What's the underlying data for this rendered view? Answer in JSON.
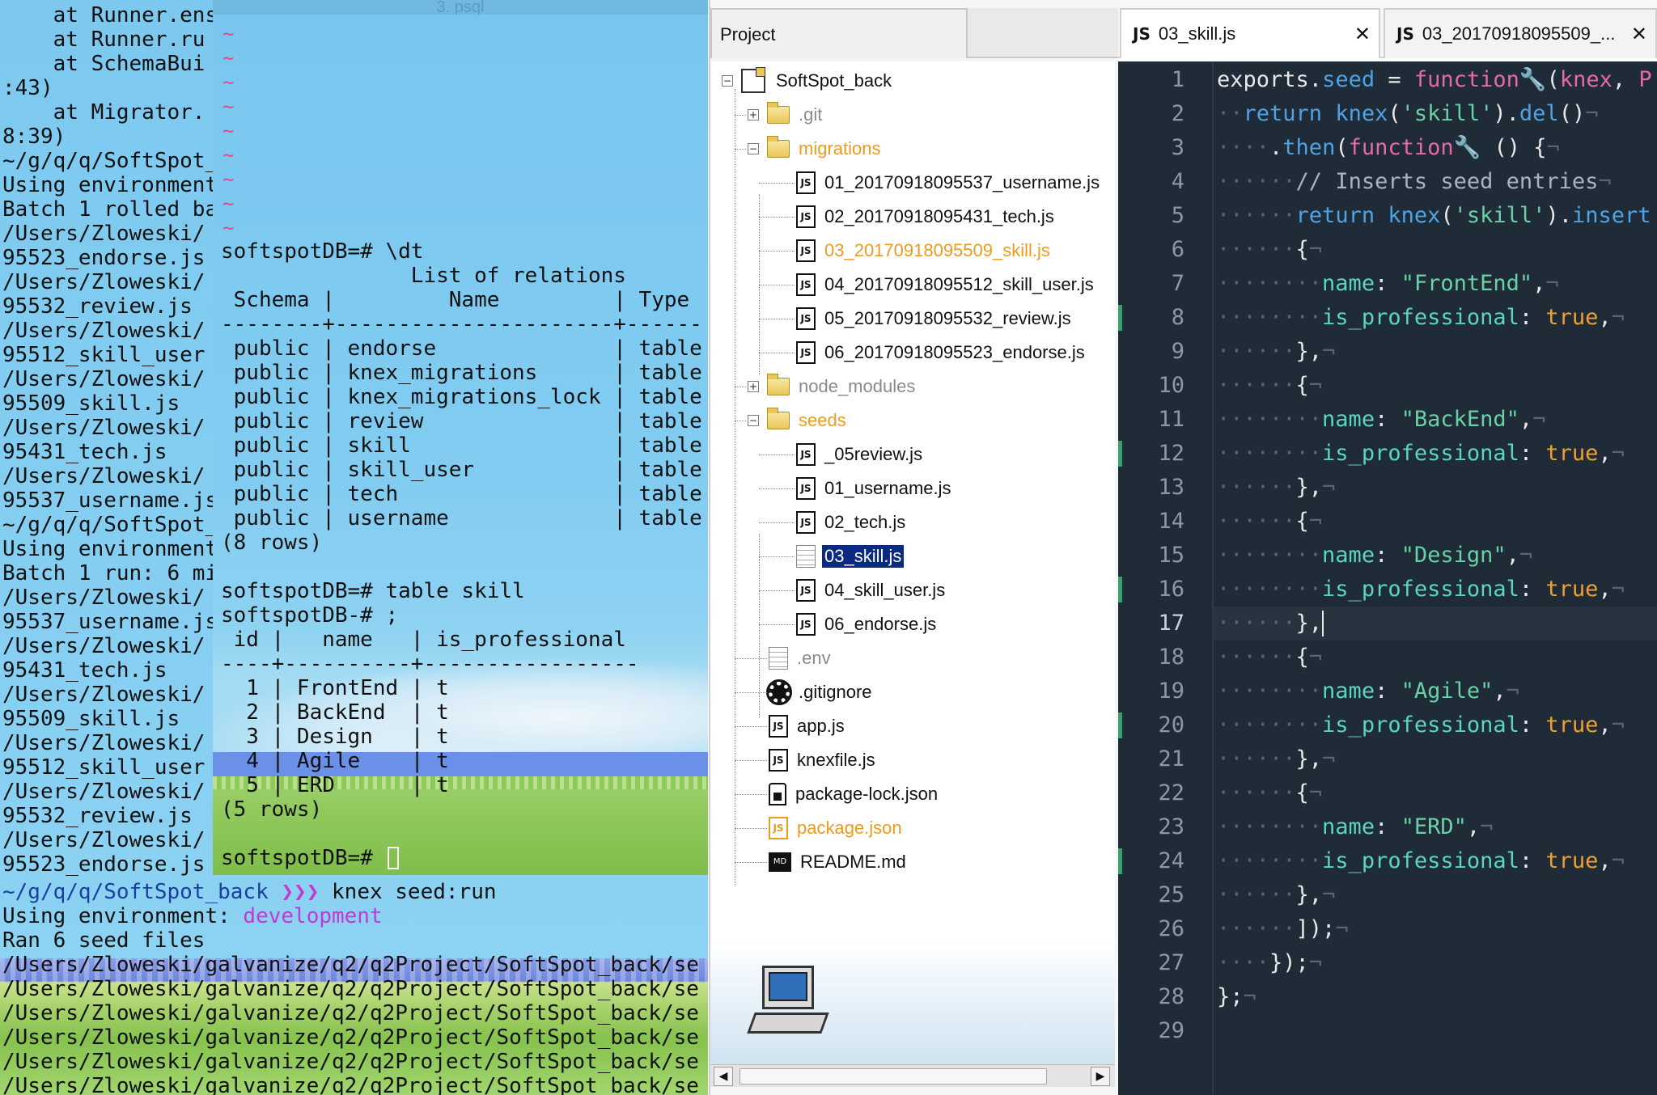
{
  "back_terminal": {
    "lines": [
      {
        "text": "    at Runner.ens",
        "cls": "c-dk"
      },
      {
        "text": "    at Runner.ru",
        "cls": "c-dk"
      },
      {
        "text": "    at SchemaBui",
        "cls": "c-dk"
      },
      {
        "text": ":43)",
        "cls": "c-dk"
      },
      {
        "text": "    at Migrator.",
        "cls": "c-dk"
      },
      {
        "text": "8:39)",
        "cls": "c-dk"
      },
      {
        "text": "~/g/q/q/SoftSpot_",
        "cls": "c-blue"
      },
      {
        "text": "Using environment",
        "cls": "c-dk"
      },
      {
        "text": "Batch 1 rolled ba",
        "cls": "c-green"
      },
      {
        "text": "/Users/Zloweski/",
        "cls": "c-teal"
      },
      {
        "text": "95523_endorse.js",
        "cls": "c-teal"
      },
      {
        "text": "/Users/Zloweski/",
        "cls": "c-teal"
      },
      {
        "text": "95532_review.js",
        "cls": "c-teal"
      },
      {
        "text": "/Users/Zloweski/",
        "cls": "c-teal"
      },
      {
        "text": "95512_skill_user",
        "cls": "c-teal"
      },
      {
        "text": "/Users/Zloweski/",
        "cls": "c-teal"
      },
      {
        "text": "95509_skill.js",
        "cls": "c-teal"
      },
      {
        "text": "/Users/Zloweski/",
        "cls": "c-teal"
      },
      {
        "text": "95431_tech.js",
        "cls": "c-teal"
      },
      {
        "text": "/Users/Zloweski/",
        "cls": "c-teal"
      },
      {
        "text": "95537_username.js",
        "cls": "c-teal"
      },
      {
        "text": "~/g/q/q/SoftSpot_",
        "cls": "c-blue"
      },
      {
        "text": "Using environment",
        "cls": "c-dk"
      },
      {
        "text": "Batch 1 run: 6 mi",
        "cls": "c-green"
      },
      {
        "text": "/Users/Zloweski/",
        "cls": "c-teal"
      },
      {
        "text": "95537_username.js",
        "cls": "c-teal"
      },
      {
        "text": "/Users/Zloweski/",
        "cls": "c-teal"
      },
      {
        "text": "95431_tech.js",
        "cls": "c-teal"
      },
      {
        "text": "/Users/Zloweski/",
        "cls": "c-teal"
      },
      {
        "text": "95509_skill.js",
        "cls": "c-teal"
      },
      {
        "text": "/Users/Zloweski/",
        "cls": "c-teal"
      },
      {
        "text": "95512_skill_user",
        "cls": "c-teal"
      },
      {
        "text": "/Users/Zloweski/",
        "cls": "c-teal"
      },
      {
        "text": "95532_review.js",
        "cls": "c-teal"
      },
      {
        "text": "/Users/Zloweski/",
        "cls": "c-teal"
      },
      {
        "text": "95523_endorse.js",
        "cls": "c-teal"
      }
    ],
    "prompt_path": "~/g/q/q/SoftSpot_back",
    "prompt_arrows": "❯❯❯",
    "command": "knex seed:run",
    "env_label": "Using environment:",
    "env_value": "development",
    "ran_message": "Ran 6 seed files",
    "seed_paths": [
      "/Users/Zloweski/galvanize/q2/q2Project/SoftSpot_back/se",
      "/Users/Zloweski/galvanize/q2/q2Project/SoftSpot_back/se",
      "/Users/Zloweski/galvanize/q2/q2Project/SoftSpot_back/se",
      "/Users/Zloweski/galvanize/q2/q2Project/SoftSpot_back/se",
      "/Users/Zloweski/galvanize/q2/q2Project/SoftSpot_back/se",
      "/Users/Zloweski/galvanize/q2/q2Project/SoftSpot_back/se"
    ]
  },
  "psql": {
    "title": "3. psql",
    "tildes": [
      "~",
      "~",
      "~",
      "~",
      "~",
      "~",
      "~",
      "~",
      "~"
    ],
    "lines": [
      "softspotDB=# \\dt",
      "               List of relations",
      " Schema |         Name         | Type",
      "--------+----------------------+------",
      " public | endorse              | table",
      " public | knex_migrations      | table",
      " public | knex_migrations_lock | table",
      " public | review               | table",
      " public | skill                | table",
      " public | skill_user           | table",
      " public | tech                 | table",
      " public | username             | table",
      "(8 rows)",
      "",
      "softspotDB=# table skill",
      "softspotDB-# ;",
      " id |   name   | is_professional",
      "----+----------+-----------------",
      "  1 | FrontEnd | t",
      "  2 | BackEnd  | t",
      "  3 | Design   | t",
      "  4 | Agile    | t",
      "  5 | ERD      | t",
      "(5 rows)",
      "",
      "softspotDB=# "
    ]
  },
  "project": {
    "title": "Project",
    "scroll_left": "◀",
    "scroll_right": "▶",
    "tree": [
      {
        "label": "SoftSpot_back",
        "icon": "project-icon",
        "depth": 0,
        "toggle": "−",
        "style": ""
      },
      {
        "label": ".git",
        "icon": "folder-icon",
        "depth": 1,
        "toggle": "+",
        "style": "dim"
      },
      {
        "label": "migrations",
        "icon": "folder-open-icon",
        "depth": 1,
        "toggle": "−",
        "style": "orange"
      },
      {
        "label": "01_20170918095537_username.js",
        "icon": "js-file-icon",
        "depth": 2,
        "toggle": "",
        "style": ""
      },
      {
        "label": "02_20170918095431_tech.js",
        "icon": "js-file-icon",
        "depth": 2,
        "toggle": "",
        "style": ""
      },
      {
        "label": "03_20170918095509_skill.js",
        "icon": "js-file-icon",
        "depth": 2,
        "toggle": "",
        "style": "orange"
      },
      {
        "label": "04_20170918095512_skill_user.js",
        "icon": "js-file-icon",
        "depth": 2,
        "toggle": "",
        "style": ""
      },
      {
        "label": "05_20170918095532_review.js",
        "icon": "js-file-icon",
        "depth": 2,
        "toggle": "",
        "style": ""
      },
      {
        "label": "06_20170918095523_endorse.js",
        "icon": "js-file-icon",
        "depth": 2,
        "toggle": "",
        "style": ""
      },
      {
        "label": "node_modules",
        "icon": "folder-icon",
        "depth": 1,
        "toggle": "+",
        "style": "dim"
      },
      {
        "label": "seeds",
        "icon": "folder-open-icon",
        "depth": 1,
        "toggle": "−",
        "style": "orange"
      },
      {
        "label": "_05review.js",
        "icon": "js-file-icon",
        "depth": 2,
        "toggle": "",
        "style": ""
      },
      {
        "label": "01_username.js",
        "icon": "js-file-icon",
        "depth": 2,
        "toggle": "",
        "style": ""
      },
      {
        "label": "02_tech.js",
        "icon": "js-file-icon",
        "depth": 2,
        "toggle": "",
        "style": ""
      },
      {
        "label": "03_skill.js",
        "icon": "text-file-icon",
        "depth": 2,
        "toggle": "",
        "style": "sel"
      },
      {
        "label": "04_skill_user.js",
        "icon": "js-file-icon",
        "depth": 2,
        "toggle": "",
        "style": ""
      },
      {
        "label": "06_endorse.js",
        "icon": "js-file-icon",
        "depth": 2,
        "toggle": "",
        "style": ""
      },
      {
        "label": ".env",
        "icon": "text-file-icon",
        "depth": 1,
        "toggle": "",
        "style": "dim"
      },
      {
        "label": ".gitignore",
        "icon": "gear-icon",
        "depth": 1,
        "toggle": "",
        "style": ""
      },
      {
        "label": "app.js",
        "icon": "js-file-icon",
        "depth": 1,
        "toggle": "",
        "style": ""
      },
      {
        "label": "knexfile.js",
        "icon": "js-file-icon",
        "depth": 1,
        "toggle": "",
        "style": ""
      },
      {
        "label": "package-lock.json",
        "icon": "lock-file-icon",
        "depth": 1,
        "toggle": "",
        "style": ""
      },
      {
        "label": "package.json",
        "icon": "json-file-icon",
        "depth": 1,
        "toggle": "",
        "style": "orange"
      },
      {
        "label": "README.md",
        "icon": "markdown-file-icon",
        "depth": 1,
        "toggle": "",
        "style": ""
      }
    ],
    "js_badge": "JS",
    "md_badge": "MD"
  },
  "editor": {
    "tabs": [
      {
        "badge": "JS",
        "label": "03_skill.js",
        "close": "✕",
        "active": true
      },
      {
        "badge": "JS",
        "label": "03_20170918095509_...",
        "close": "✕",
        "active": false
      }
    ],
    "line_numbers": [
      "1",
      "2",
      "3",
      "4",
      "5",
      "6",
      "7",
      "8",
      "9",
      "10",
      "11",
      "12",
      "13",
      "14",
      "15",
      "16",
      "17",
      "18",
      "19",
      "20",
      "21",
      "22",
      "23",
      "24",
      "25",
      "26",
      "27",
      "28",
      "29"
    ],
    "modified_lines": [
      8,
      12,
      16,
      20,
      24
    ],
    "current_line": 17,
    "code": [
      [
        [
          "k-id",
          "exports"
        ],
        [
          "k-op",
          "."
        ],
        [
          "k-prop",
          "seed"
        ],
        [
          "k-op",
          " = "
        ],
        [
          "k-fn",
          "function"
        ],
        [
          "k-ic",
          "🔧"
        ],
        [
          "k-op",
          "("
        ],
        [
          "k-fn",
          "knex"
        ],
        [
          "k-op",
          ", "
        ],
        [
          "k-fn",
          "P"
        ]
      ],
      [
        [
          "ws",
          "··"
        ],
        [
          "k-ret",
          "return "
        ],
        [
          "k-kn",
          "knex"
        ],
        [
          "k-op",
          "("
        ],
        [
          "k-str",
          "'skill'"
        ],
        [
          "k-op",
          ")."
        ],
        [
          "k-prop",
          "del"
        ],
        [
          "k-op",
          "()"
        ],
        [
          "ws",
          "¬"
        ]
      ],
      [
        [
          "ws",
          "··"
        ],
        [
          "ws",
          "··"
        ],
        [
          "k-op",
          "."
        ],
        [
          "k-prop",
          "then"
        ],
        [
          "k-op",
          "("
        ],
        [
          "k-fn",
          "function"
        ],
        [
          "k-ic",
          "🔧"
        ],
        [
          "k-op",
          " () {"
        ],
        [
          "ws",
          "¬"
        ]
      ],
      [
        [
          "ws",
          "······"
        ],
        [
          "k-cm",
          "// Inserts seed entries"
        ],
        [
          "ws",
          "¬"
        ]
      ],
      [
        [
          "ws",
          "······"
        ],
        [
          "k-ret",
          "return "
        ],
        [
          "k-kn",
          "knex"
        ],
        [
          "k-op",
          "("
        ],
        [
          "k-str",
          "'skill'"
        ],
        [
          "k-op",
          ")."
        ],
        [
          "k-prop",
          "insert"
        ]
      ],
      [
        [
          "ws",
          "······"
        ],
        [
          "k-op",
          "{"
        ],
        [
          "ws",
          "¬"
        ]
      ],
      [
        [
          "ws",
          "········"
        ],
        [
          "k-key",
          "name"
        ],
        [
          "k-op",
          ": "
        ],
        [
          "k-str",
          "\"FrontEnd\""
        ],
        [
          "k-op",
          ","
        ],
        [
          "ws",
          "¬"
        ]
      ],
      [
        [
          "ws",
          "········"
        ],
        [
          "k-key",
          "is_professional"
        ],
        [
          "k-op",
          ": "
        ],
        [
          "k-bool",
          "true"
        ],
        [
          "k-op",
          ","
        ],
        [
          "ws",
          "¬"
        ]
      ],
      [
        [
          "ws",
          "······"
        ],
        [
          "k-op",
          "},"
        ],
        [
          "ws",
          "¬"
        ]
      ],
      [
        [
          "ws",
          "······"
        ],
        [
          "k-op",
          "{"
        ],
        [
          "ws",
          "¬"
        ]
      ],
      [
        [
          "ws",
          "········"
        ],
        [
          "k-key",
          "name"
        ],
        [
          "k-op",
          ": "
        ],
        [
          "k-str",
          "\"BackEnd\""
        ],
        [
          "k-op",
          ","
        ],
        [
          "ws",
          "¬"
        ]
      ],
      [
        [
          "ws",
          "········"
        ],
        [
          "k-key",
          "is_professional"
        ],
        [
          "k-op",
          ": "
        ],
        [
          "k-bool",
          "true"
        ],
        [
          "k-op",
          ","
        ],
        [
          "ws",
          "¬"
        ]
      ],
      [
        [
          "ws",
          "······"
        ],
        [
          "k-op",
          "},"
        ],
        [
          "ws",
          "¬"
        ]
      ],
      [
        [
          "ws",
          "······"
        ],
        [
          "k-op",
          "{"
        ],
        [
          "ws",
          "¬"
        ]
      ],
      [
        [
          "ws",
          "········"
        ],
        [
          "k-key",
          "name"
        ],
        [
          "k-op",
          ": "
        ],
        [
          "k-str",
          "\"Design\""
        ],
        [
          "k-op",
          ","
        ],
        [
          "ws",
          "¬"
        ]
      ],
      [
        [
          "ws",
          "········"
        ],
        [
          "k-key",
          "is_professional"
        ],
        [
          "k-op",
          ": "
        ],
        [
          "k-bool",
          "true"
        ],
        [
          "k-op",
          ","
        ],
        [
          "ws",
          "¬"
        ]
      ],
      [
        [
          "ws",
          "······"
        ],
        [
          "k-op",
          "},"
        ]
      ],
      [
        [
          "ws",
          "······"
        ],
        [
          "k-op",
          "{"
        ],
        [
          "ws",
          "¬"
        ]
      ],
      [
        [
          "ws",
          "········"
        ],
        [
          "k-key",
          "name"
        ],
        [
          "k-op",
          ": "
        ],
        [
          "k-str",
          "\"Agile\""
        ],
        [
          "k-op",
          ","
        ],
        [
          "ws",
          "¬"
        ]
      ],
      [
        [
          "ws",
          "········"
        ],
        [
          "k-key",
          "is_professional"
        ],
        [
          "k-op",
          ": "
        ],
        [
          "k-bool",
          "true"
        ],
        [
          "k-op",
          ","
        ],
        [
          "ws",
          "¬"
        ]
      ],
      [
        [
          "ws",
          "······"
        ],
        [
          "k-op",
          "},"
        ],
        [
          "ws",
          "¬"
        ]
      ],
      [
        [
          "ws",
          "······"
        ],
        [
          "k-op",
          "{"
        ],
        [
          "ws",
          "¬"
        ]
      ],
      [
        [
          "ws",
          "········"
        ],
        [
          "k-key",
          "name"
        ],
        [
          "k-op",
          ": "
        ],
        [
          "k-str",
          "\"ERD\""
        ],
        [
          "k-op",
          ","
        ],
        [
          "ws",
          "¬"
        ]
      ],
      [
        [
          "ws",
          "········"
        ],
        [
          "k-key",
          "is_professional"
        ],
        [
          "k-op",
          ": "
        ],
        [
          "k-bool",
          "true"
        ],
        [
          "k-op",
          ","
        ],
        [
          "ws",
          "¬"
        ]
      ],
      [
        [
          "ws",
          "······"
        ],
        [
          "k-op",
          "},"
        ],
        [
          "ws",
          "¬"
        ]
      ],
      [
        [
          "ws",
          "······"
        ],
        [
          "k-op",
          "]);"
        ],
        [
          "ws",
          "¬"
        ]
      ],
      [
        [
          "ws",
          "····"
        ],
        [
          "k-op",
          "});"
        ],
        [
          "ws",
          "¬"
        ]
      ],
      [
        [
          "k-op",
          "};"
        ],
        [
          "ws",
          "¬"
        ]
      ],
      []
    ]
  }
}
